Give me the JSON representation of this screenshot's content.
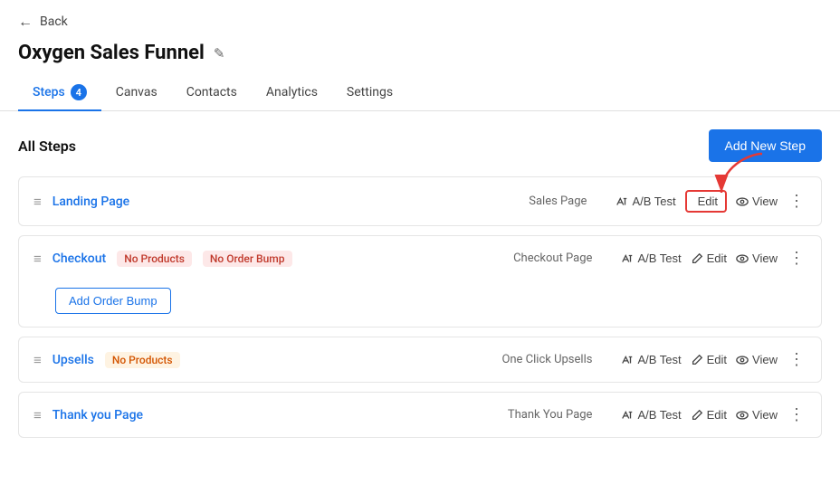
{
  "back": {
    "label": "Back"
  },
  "page": {
    "title": "Oxygen Sales Funnel"
  },
  "tabs": [
    {
      "id": "steps",
      "label": "Steps",
      "badge": "4",
      "active": true
    },
    {
      "id": "canvas",
      "label": "Canvas",
      "badge": null,
      "active": false
    },
    {
      "id": "contacts",
      "label": "Contacts",
      "badge": null,
      "active": false
    },
    {
      "id": "analytics",
      "label": "Analytics",
      "badge": null,
      "active": false
    },
    {
      "id": "settings",
      "label": "Settings",
      "badge": null,
      "active": false
    }
  ],
  "section": {
    "title": "All Steps",
    "add_button": "Add New Step"
  },
  "steps": [
    {
      "id": "landing-page",
      "name": "Landing Page",
      "badges": [],
      "type": "Sales Page",
      "actions": [
        "A/B Test",
        "Edit",
        "View"
      ],
      "edit_highlighted": true
    },
    {
      "id": "checkout",
      "name": "Checkout",
      "badges": [
        "No Products",
        "No Order Bump"
      ],
      "badge_colors": [
        "red",
        "red"
      ],
      "type": "Checkout Page",
      "actions": [
        "A/B Test",
        "Edit",
        "View"
      ],
      "edit_highlighted": false,
      "has_order_bump": true
    },
    {
      "id": "upsells",
      "name": "Upsells",
      "badges": [
        "No Products"
      ],
      "badge_colors": [
        "orange"
      ],
      "type": "One Click Upsells",
      "actions": [
        "A/B Test",
        "Edit",
        "View"
      ],
      "edit_highlighted": false
    },
    {
      "id": "thank-you-page",
      "name": "Thank you Page",
      "badges": [],
      "type": "Thank You Page",
      "actions": [
        "A/B Test",
        "Edit",
        "View"
      ],
      "edit_highlighted": false
    }
  ],
  "order_bump_button": "Add Order Bump"
}
